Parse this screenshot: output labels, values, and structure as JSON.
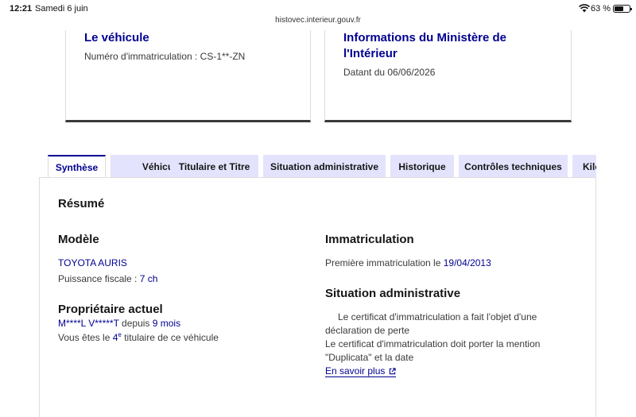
{
  "status_bar": {
    "time": "12:21",
    "date": "Samedi 6 juin",
    "battery_label": "63 %",
    "battery_level": 0.63
  },
  "url": "histovec.interieur.gouv.fr",
  "cards": {
    "vehicle": {
      "title": "Le véhicule",
      "text": "Numéro d'immatriculation : CS-1**-ZN"
    },
    "ministry": {
      "title": "Informations du Ministère de l'Intérieur",
      "text": "Datant du 06/06/2026"
    }
  },
  "tabs": [
    {
      "label": "Synthèse"
    },
    {
      "label": "Véhicule"
    },
    {
      "label": "Titulaire et Titre"
    },
    {
      "label": "Situation administrative"
    },
    {
      "label": "Historique"
    },
    {
      "label": "Contrôles techniques"
    },
    {
      "label": "Kilo"
    }
  ],
  "summary": {
    "title": "Résumé",
    "model": {
      "heading": "Modèle",
      "name": "TOYOTA AURIS",
      "fiscal_label": "Puissance fiscale : ",
      "fiscal_value": "7 ch"
    },
    "owner": {
      "heading": "Propriétaire actuel",
      "name": "M****L V*****T",
      "since_label": " depuis ",
      "since_value": "9 mois",
      "rank_prefix": "Vous êtes le ",
      "rank_value": "4",
      "rank_sup": "e",
      "rank_suffix": " titulaire de ce véhicule"
    },
    "registration": {
      "heading": "Immatriculation",
      "label": "Première immatriculation le ",
      "date": "19/04/2013"
    },
    "admin": {
      "heading": "Situation administrative",
      "line1": "Le certificat d'immatriculation a fait l'objet d'une",
      "line2": "déclaration de perte",
      "line3": "Le certificat d'immatriculation doit porter la mention",
      "line4": "\"Duplicata\" et la date",
      "more_link": "En savoir plus"
    }
  }
}
